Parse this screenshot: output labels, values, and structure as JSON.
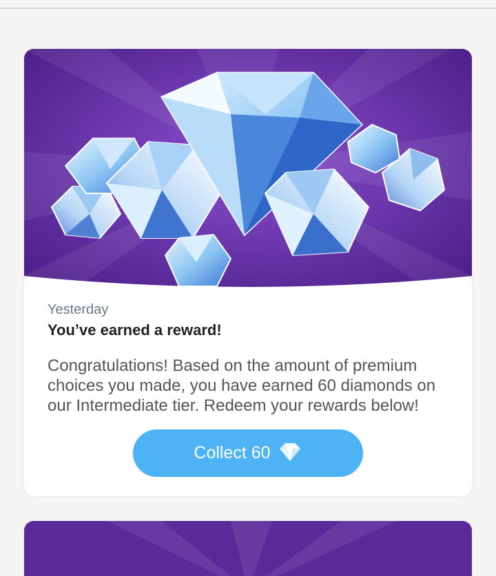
{
  "notification": {
    "date": "Yesterday",
    "title": "You’ve earned a reward!",
    "message": "Congratulations! Based on the amount of premium choices you made, you have earned 60 diamonds on our Intermediate tier. Redeem your rewards below!",
    "button_label": "Collect 60",
    "button_icon": "diamond-icon"
  },
  "hero": {
    "image": "diamonds-illustration",
    "background_color": "#5b2a99"
  },
  "colors": {
    "accent": "#4db3f5",
    "page_background": "#f5f5f5",
    "card_background": "#ffffff"
  }
}
